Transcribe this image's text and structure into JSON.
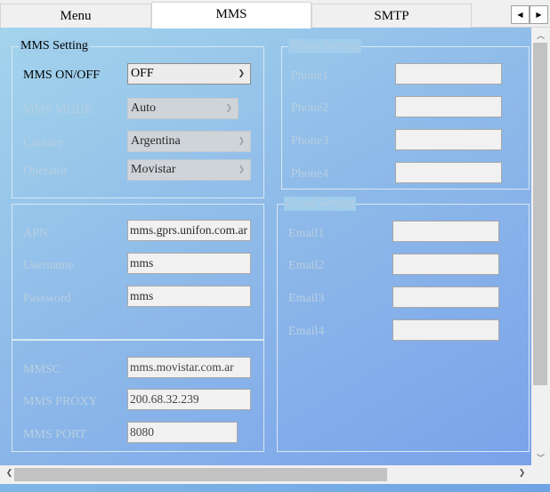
{
  "tabs": [
    {
      "label": "Menu",
      "active": false
    },
    {
      "label": "MMS",
      "active": true
    },
    {
      "label": "SMTP",
      "active": false
    }
  ],
  "mms_setting": {
    "legend": "MMS Setting",
    "onoff_label": "MMS ON/OFF",
    "onoff_value": "OFF",
    "mode_label": "MMS MODE",
    "mode_value": "Auto",
    "country_label": "Country",
    "country_value": "Argentina",
    "operator_label": "Operator",
    "operator_value": "Movistar"
  },
  "apn_group": {
    "apn_label": "APN",
    "apn_value": "mms.gprs.unifon.com.ar",
    "username_label": "Username",
    "username_value": "mms",
    "password_label": "Password",
    "password_value": "mms"
  },
  "mmsc_group": {
    "mmsc_label": "MMSC",
    "mmsc_value": "mms.movistar.com.ar",
    "proxy_label": "MMS PROXY",
    "proxy_value": "200.68.32.239",
    "port_label": "MMS PORT",
    "port_value": "8080"
  },
  "phone_setting": {
    "legend": "Phone Setting",
    "phone1_label": "Phone1",
    "phone2_label": "Phone2",
    "phone3_label": "Phone3",
    "phone4_label": "Phone4"
  },
  "email_setting": {
    "legend": "Email Setting",
    "email1_label": "Email1",
    "email2_label": "Email2",
    "email3_label": "Email3",
    "email4_label": "Email4"
  },
  "colors": {
    "panel_gradient_start": "#a3d4ec",
    "panel_gradient_end": "#7aa2ea",
    "disabled_text": "#b8cfe0"
  }
}
